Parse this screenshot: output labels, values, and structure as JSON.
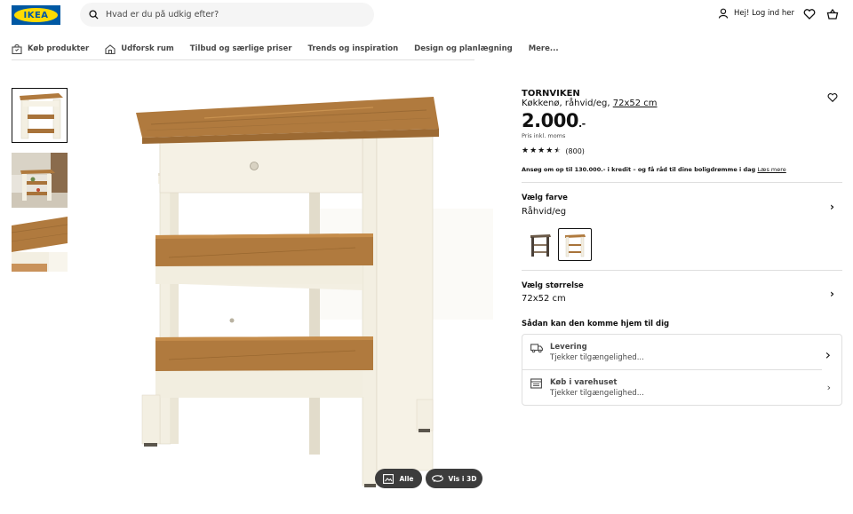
{
  "header": {
    "logo_text": "IKEA",
    "search_placeholder": "Hvad er du på udkig efter?",
    "login_label": "Hej! Log ind her"
  },
  "nav": {
    "items": [
      {
        "label": "Køb produkter",
        "icon": "shopping-bag-icon"
      },
      {
        "label": "Udforsk rum",
        "icon": "house-icon"
      },
      {
        "label": "Tilbud og særlige priser"
      },
      {
        "label": "Trends og inspiration"
      },
      {
        "label": "Design og planlægning"
      },
      {
        "label": "Mere..."
      }
    ]
  },
  "gallery": {
    "buttons": {
      "all_label": "Alle",
      "view3d_label": "Vis i 3D"
    }
  },
  "product": {
    "name": "TORNVIKEN",
    "desc_prefix": "Køkkenø, råhvid/eg, ",
    "size_link": "72x52 cm",
    "price": "2.000",
    "price_suffix": ".-",
    "vat_note": "Pris inkl. moms",
    "rating": 4.5,
    "review_count": "(800)",
    "credit_text": "Ansøg om op til 130.000.- i kredit – og få råd til dine boligdrømme i dag",
    "credit_link": "Læs mere"
  },
  "color_section": {
    "label": "Vælg farve",
    "value": "Råhvid/eg"
  },
  "size_section": {
    "label": "Vælg størrelse",
    "value": "72x52 cm"
  },
  "delivery": {
    "heading": "Sådan kan den komme hjem til dig",
    "rows": [
      {
        "title": "Levering",
        "status": "Tjekker tilgængelighed...",
        "icon": "truck-icon"
      },
      {
        "title": "Køb i varehuset",
        "status": "Tjekker tilgængelighed...",
        "icon": "store-icon"
      }
    ]
  },
  "colors": {
    "brand_blue": "#0058a3",
    "brand_yellow": "#ffdb00",
    "oak": "#b07a3e",
    "offwhite": "#f3efe2"
  }
}
